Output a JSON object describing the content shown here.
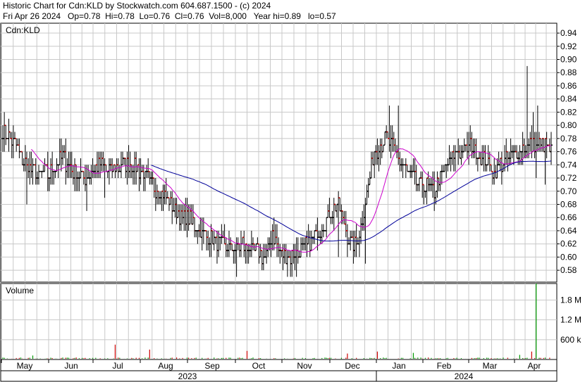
{
  "header": {
    "line1": "Historic Chart for Cdn:KLD by Stockwatch.com 604.687.1500 - (c) 2024",
    "line2": "Fri Apr 26 2024   Op=0.78  Hi=0.78  Lo=0.76  Cl=0.76  Vol=8,000   Year hi=0.89   lo=0.57"
  },
  "chart_data": {
    "type": "ohlc",
    "symbol_label": "Cdn:KLD",
    "volume_label": "Volume",
    "ylim": [
      0.562,
      0.955
    ],
    "y_ticks": [
      0.58,
      0.6,
      0.62,
      0.64,
      0.66,
      0.68,
      0.7,
      0.72,
      0.74,
      0.76,
      0.78,
      0.8,
      0.82,
      0.84,
      0.86,
      0.88,
      0.9,
      0.92,
      0.94
    ],
    "volume_ticks": [
      {
        "value": 600000,
        "label": "600 k"
      },
      {
        "value": 1200000,
        "label": "1.2 M"
      },
      {
        "value": 1800000,
        "label": "1.8 M"
      }
    ],
    "volume_max": 2300000,
    "months": [
      "May",
      "Jun",
      "Jul",
      "Aug",
      "Sep",
      "Oct",
      "Nov",
      "Dec",
      "Jan",
      "Feb",
      "Mar",
      "Apr"
    ],
    "years": [
      "2023",
      "2024"
    ],
    "grid": true,
    "colors": {
      "up": "#000000",
      "down": "#cc0000",
      "ma_short": "#cc00cc",
      "ma_long": "#000099",
      "volume_up": "#009900",
      "volume_down": "#cc0000",
      "grid": "#c8c8c8"
    },
    "anchors": [
      [
        0,
        0.79
      ],
      [
        8,
        0.77
      ],
      [
        16,
        0.74
      ],
      [
        24,
        0.72
      ],
      [
        32,
        0.73
      ],
      [
        40,
        0.75
      ],
      [
        48,
        0.73
      ],
      [
        56,
        0.72
      ],
      [
        64,
        0.74
      ],
      [
        72,
        0.73
      ],
      [
        80,
        0.74
      ],
      [
        88,
        0.74
      ],
      [
        96,
        0.72
      ],
      [
        104,
        0.7
      ],
      [
        112,
        0.68
      ],
      [
        120,
        0.66
      ],
      [
        128,
        0.65
      ],
      [
        136,
        0.63
      ],
      [
        144,
        0.62
      ],
      [
        152,
        0.61
      ],
      [
        160,
        0.62
      ],
      [
        168,
        0.61
      ],
      [
        176,
        0.6
      ],
      [
        180,
        0.64
      ],
      [
        184,
        0.61
      ],
      [
        192,
        0.6
      ],
      [
        200,
        0.61
      ],
      [
        208,
        0.63
      ],
      [
        216,
        0.66
      ],
      [
        220,
        0.67
      ],
      [
        224,
        0.68
      ],
      [
        228,
        0.65
      ],
      [
        232,
        0.62
      ],
      [
        236,
        0.62
      ],
      [
        240,
        0.66
      ],
      [
        248,
        0.76
      ],
      [
        256,
        0.78
      ],
      [
        264,
        0.75
      ],
      [
        272,
        0.72
      ],
      [
        280,
        0.71
      ],
      [
        288,
        0.7
      ],
      [
        296,
        0.74
      ],
      [
        304,
        0.76
      ],
      [
        312,
        0.77
      ],
      [
        320,
        0.75
      ],
      [
        328,
        0.73
      ],
      [
        336,
        0.75
      ],
      [
        344,
        0.76
      ],
      [
        352,
        0.77
      ],
      [
        360,
        0.77
      ],
      [
        366,
        0.76
      ]
    ],
    "special_highs": [
      [
        350,
        0.89
      ],
      [
        357,
        0.83
      ],
      [
        354,
        0.82
      ],
      [
        258,
        0.83
      ],
      [
        264,
        0.83
      ],
      [
        312,
        0.8
      ]
    ],
    "special_lows": [
      [
        0,
        0.76
      ],
      [
        16,
        0.68
      ],
      [
        56,
        0.67
      ],
      [
        68,
        0.69
      ],
      [
        156,
        0.57
      ],
      [
        196,
        0.57
      ],
      [
        224,
        0.6
      ],
      [
        242,
        0.59
      ],
      [
        282,
        0.69
      ],
      [
        356,
        0.72
      ],
      [
        362,
        0.71
      ]
    ],
    "volume_spikes": [
      [
        356,
        2300000
      ],
      [
        353,
        240000
      ],
      [
        75,
        450000
      ],
      [
        98,
        300000
      ],
      [
        163,
        260000
      ],
      [
        250,
        240000
      ],
      [
        274,
        200000
      ],
      [
        230,
        180000
      ],
      [
        20,
        120000
      ],
      [
        345,
        140000
      ]
    ]
  }
}
